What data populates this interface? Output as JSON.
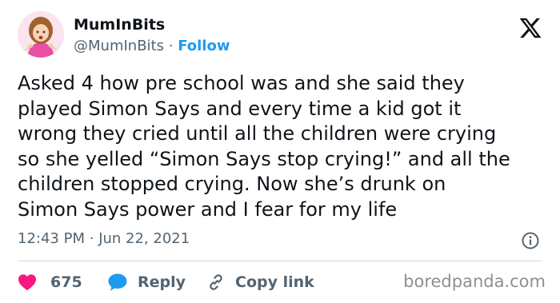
{
  "author": {
    "display_name": "MumInBits",
    "handle": "@MumInBits",
    "separator": "·",
    "follow_label": "Follow"
  },
  "tweet": {
    "lines": [
      "Asked 4 how pre school was and she said they",
      "played Simon Says and every time a kid got it",
      "wrong they cried until all the children were crying",
      "so she yelled “Simon Says stop crying!” and all the",
      "children stopped crying. Now she’s drunk on",
      "Simon Says power and I fear for my life"
    ],
    "time": "12:43 PM",
    "separator": "·",
    "date": "Jun 22, 2021"
  },
  "actions": {
    "like_count": "675",
    "reply_label": "Reply",
    "copy_link_label": "Copy link"
  },
  "watermark": "boredpanda.com",
  "icons": {
    "platform": "x-logo-icon",
    "info": "info-icon",
    "like": "heart-icon",
    "reply": "speech-bubble-icon",
    "copy": "link-icon"
  },
  "colors": {
    "link_blue": "#1d9bf0",
    "like_pink": "#f91880",
    "secondary_text": "#536471"
  }
}
